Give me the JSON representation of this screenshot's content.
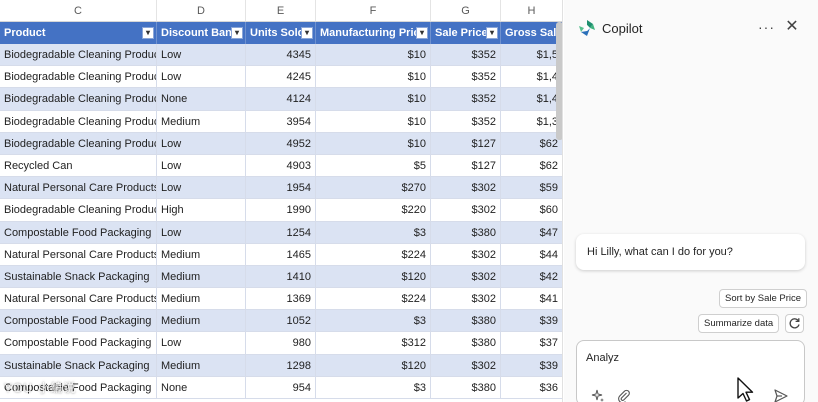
{
  "sheet": {
    "column_letters": [
      "C",
      "D",
      "E",
      "F",
      "G",
      "H"
    ],
    "headers": [
      "Product",
      "Discount Band",
      "Units Sold",
      "Manufacturing Price",
      "Sale Price",
      "Gross Sale"
    ],
    "header_fill": "#4472c4",
    "band_fill": "#dbe3f3",
    "rows": [
      [
        "Biodegradable Cleaning Products",
        "Low",
        "4345",
        "$10",
        "$352",
        "$1,5"
      ],
      [
        "Biodegradable Cleaning Products",
        "Low",
        "4245",
        "$10",
        "$352",
        "$1,4"
      ],
      [
        "Biodegradable Cleaning Products",
        "None",
        "4124",
        "$10",
        "$352",
        "$1,4"
      ],
      [
        "Biodegradable Cleaning Products",
        "Medium",
        "3954",
        "$10",
        "$352",
        "$1,3"
      ],
      [
        "Biodegradable Cleaning Products",
        "Low",
        "4952",
        "$10",
        "$127",
        "$62"
      ],
      [
        "Recycled Can",
        "Low",
        "4903",
        "$5",
        "$127",
        "$62"
      ],
      [
        "Natural Personal Care Products",
        "Low",
        "1954",
        "$270",
        "$302",
        "$59"
      ],
      [
        "Biodegradable Cleaning Products",
        "High",
        "1990",
        "$220",
        "$302",
        "$60"
      ],
      [
        "Compostable Food Packaging",
        "Low",
        "1254",
        "$3",
        "$380",
        "$47"
      ],
      [
        "Natural Personal Care Products",
        "Medium",
        "1465",
        "$224",
        "$302",
        "$44"
      ],
      [
        "Sustainable Snack Packaging",
        "Medium",
        "1410",
        "$120",
        "$302",
        "$42"
      ],
      [
        "Natural Personal Care Products",
        "Medium",
        "1369",
        "$224",
        "$302",
        "$41"
      ],
      [
        "Compostable Food Packaging",
        "Medium",
        "1052",
        "$3",
        "$380",
        "$39"
      ],
      [
        "Compostable Food Packaging",
        "Low",
        "980",
        "$312",
        "$380",
        "$37"
      ],
      [
        "Sustainable Snack Packaging",
        "Medium",
        "1298",
        "$120",
        "$302",
        "$39"
      ],
      [
        "Compostable Food Packaging",
        "None",
        "954",
        "$3",
        "$380",
        "$36"
      ]
    ],
    "watermark": "YOU 小编说"
  },
  "copilot": {
    "title": "Copilot",
    "more_label": "···",
    "close_label": "✕",
    "greeting": "Hi Lilly, what can I do for you?",
    "suggestions": {
      "sort": "Sort by Sale Price",
      "summarize": "Summarize data"
    },
    "refresh_icon": "refresh-icon",
    "composer_value": "Analyz",
    "composer_icons": [
      "sparkle-icon",
      "paperclip-icon",
      "send-icon"
    ],
    "accent": "#2f7d5b"
  }
}
